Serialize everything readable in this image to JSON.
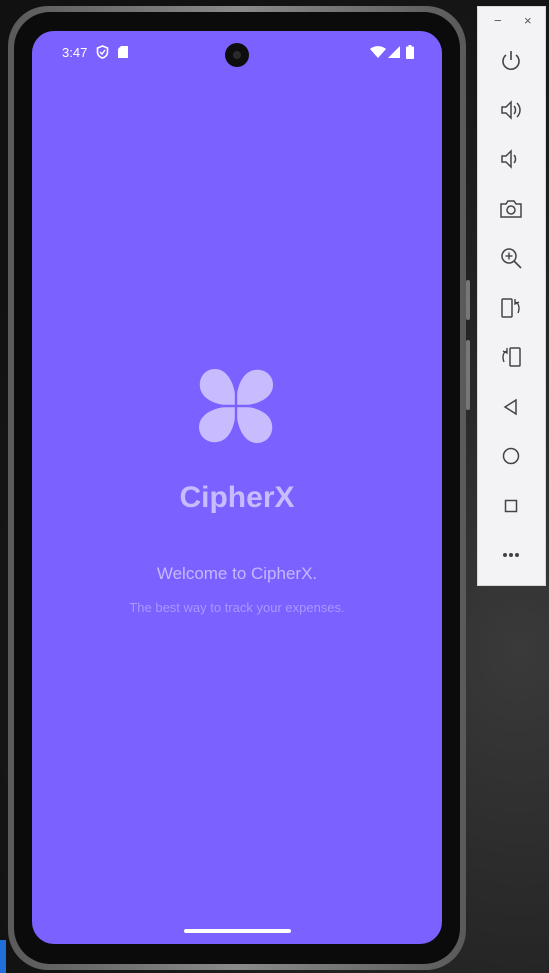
{
  "status_bar": {
    "time": "3:47"
  },
  "app": {
    "title": "CipherX",
    "welcome": "Welcome to CipherX.",
    "tagline": "The best way to track your expenses."
  },
  "colors": {
    "screen_background": "#7b61ff",
    "logo": "#c8bcff",
    "title_text": "#c8bcff",
    "toolbar_background": "#f3f3f5"
  },
  "emulator_toolbar": {
    "window_controls": {
      "minimize": "−",
      "close": "×"
    },
    "buttons": [
      "power-icon",
      "volume-up-icon",
      "volume-down-icon",
      "camera-icon",
      "zoom-in-icon",
      "rotate-left-icon",
      "rotate-right-icon",
      "back-icon",
      "home-icon",
      "overview-icon",
      "more-icon"
    ]
  }
}
